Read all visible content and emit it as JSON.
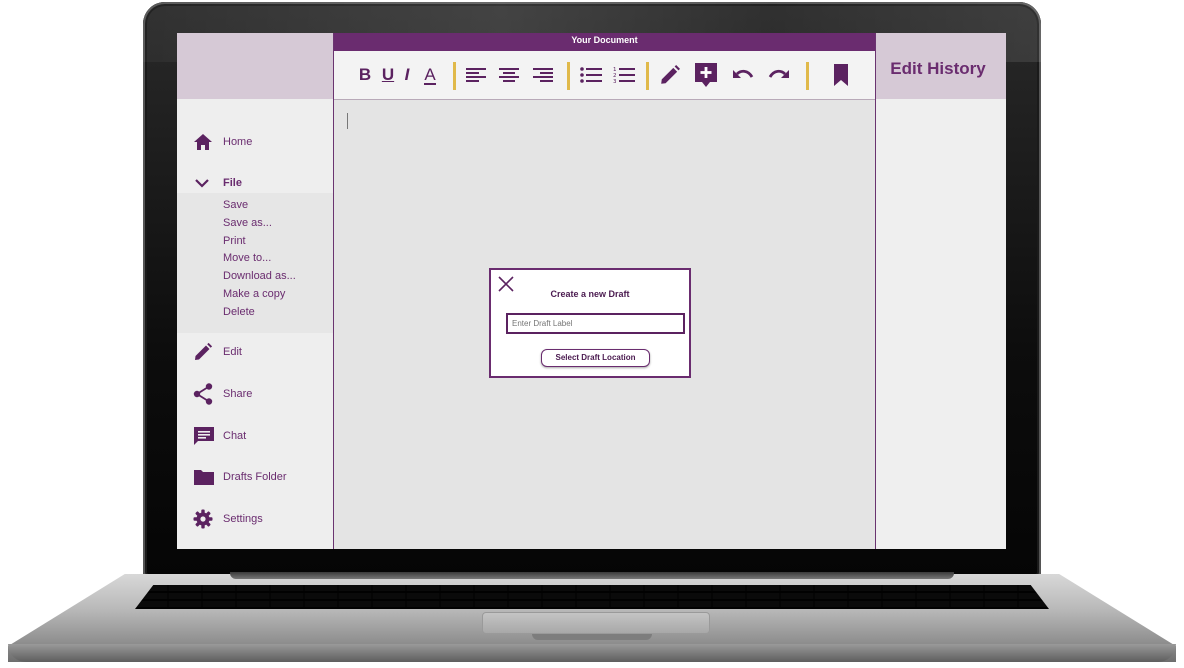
{
  "document": {
    "title": "Your Document"
  },
  "toolbar": {
    "bold": "B",
    "underline": "U",
    "italic": "I",
    "font_color": "A",
    "accent_color": "#6a2c6f",
    "separator_color": "#e0b94a"
  },
  "sidebar": {
    "home": "Home",
    "file": "File",
    "file_items": [
      "Save",
      "Save as...",
      "Print",
      "Move to...",
      "Download as...",
      "Make a copy",
      "Delete"
    ],
    "edit": "Edit",
    "share": "Share",
    "chat": "Chat",
    "drafts": "Drafts Folder",
    "settings": "Settings"
  },
  "history": {
    "title": "Edit History"
  },
  "dialog": {
    "title": "Create a new Draft",
    "input_placeholder": "Enter Draft Label",
    "button_label": "Select Draft Location"
  }
}
